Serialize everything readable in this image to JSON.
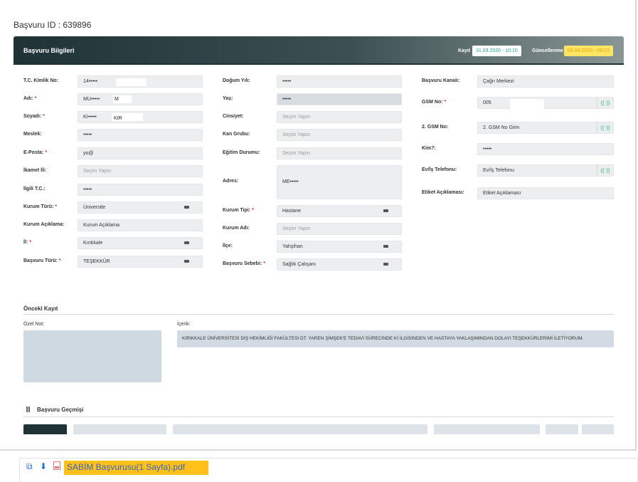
{
  "page": {
    "title": "Başvuru ID : 639896"
  },
  "header": {
    "title": "Başvuru Bilgileri",
    "kayit_label": "Kayıt",
    "kayit_value": "31.03.2026 - 10:10",
    "guncel_label": "Güncellenme",
    "guncel_value": "06.04.2026 - 09:23"
  },
  "col1": {
    "tc_label": "T.C. Kimlik No:",
    "tc_value": "14•••••",
    "adi_label": "Adı:",
    "adi_value": "MU•••••",
    "adi_extra": "M",
    "soyadi_label": "Soyadı:",
    "soyadi_value": "KI•••••",
    "soyadi_extra": "KIR",
    "meslek_label": "Meslek:",
    "meslek_value": "•••••",
    "eposta_label": "E-Posta:",
    "eposta_value": "yo@",
    "ikamet_label": "İkamet İli:",
    "ikamet_placeholder": "Seçim Yapın",
    "ilgili_label": "İlgili T.C.:",
    "ilgili_value": "•••••",
    "kurum_turu_label": "Kurum Türü:",
    "kurum_turu_value": "Üniversite",
    "kurum_aciklama_label": "Kurum Açıklama:",
    "kurum_aciklama_value": "Kurum Açıklama",
    "il_label": "İl:",
    "il_value": "Kırıkkale",
    "basvuru_turu_label": "Başvuru Türü:",
    "basvuru_turu_value": "TEŞEKKÜR"
  },
  "col2": {
    "dogum_label": "Doğum Yılı:",
    "dogum_value": "•••••",
    "yas_label": "Yaş:",
    "yas_value": "•••••",
    "cinsiyet_label": "Cinsiyet:",
    "cinsiyet_placeholder": "Seçim Yapın",
    "kan_label": "Kan Grubu:",
    "kan_placeholder": "Seçim Yapın",
    "egitim_label": "Eğitim Durumu:",
    "egitim_placeholder": "Seçim Yapın",
    "adres_label": "Adres:",
    "adres_value": "ME•••••",
    "kurum_tipi_label": "Kurum Tipi:",
    "kurum_tipi_value": "Hastane",
    "kurum_adi_label": "Kurum Adı:",
    "kurum_adi_placeholder": "Seçim Yapın",
    "ilce_label": "İlçe:",
    "ilce_value": "Yahşihan",
    "sebep_label": "Başvuru Sebebi:",
    "sebep_value": "Sağlık Çalışanı"
  },
  "col3": {
    "kanal_label": "Başvuru Kanalı:",
    "kanal_value": "Çağrı Merkezi",
    "gsm_label": "GSM No:",
    "gsm_value": "005",
    "gsm2_label": "2. GSM No:",
    "gsm2_value": "2. GSM No Girin",
    "kim_label": "Kim?:",
    "kim_value": "•••••",
    "ev_label": "Ev/İş Telefonu:",
    "ev_value": "Ev/İş Telefonu",
    "etiket_label": "Etiket Açıklaması:",
    "etiket_value": "Etiket Açıklaması"
  },
  "onceki": {
    "title": "Önceki Kayıt",
    "ozel_not_label": "Özel Not:",
    "icerik_label": "İçerik:",
    "icerik_value": "KIRIKKALE ÜNİVERSİTESİ DİŞ HEKİMLİĞİ FAKÜLTESİ DT. YAREN ŞİMŞEK'E TEDAVİ SÜRECİNDE Kİ İLGİSİNDEN VE HASTAYA YAKLAŞIMINDAN DOLAYI TEŞEKKÜRLERİMİ İLETİYORUM."
  },
  "gecmis": {
    "title": "Başvuru Geçmişi"
  },
  "footer": {
    "pdf_label": "SABİM Başvurusu(1 Sayfa).pdf"
  },
  "icons": {
    "call": "phone-call-icon",
    "dropdown": "dropdown-icon",
    "external": "external-link-icon",
    "download": "download-icon",
    "pdf": "pdf-file-icon"
  },
  "colors": {
    "header_dark": "#1f3336",
    "badge_green": "#2aa58f",
    "badge_yellow": "#ffe566",
    "required": "#d32f2f",
    "call_green": "#2eb872",
    "pdf_highlight": "#ffc01a"
  }
}
